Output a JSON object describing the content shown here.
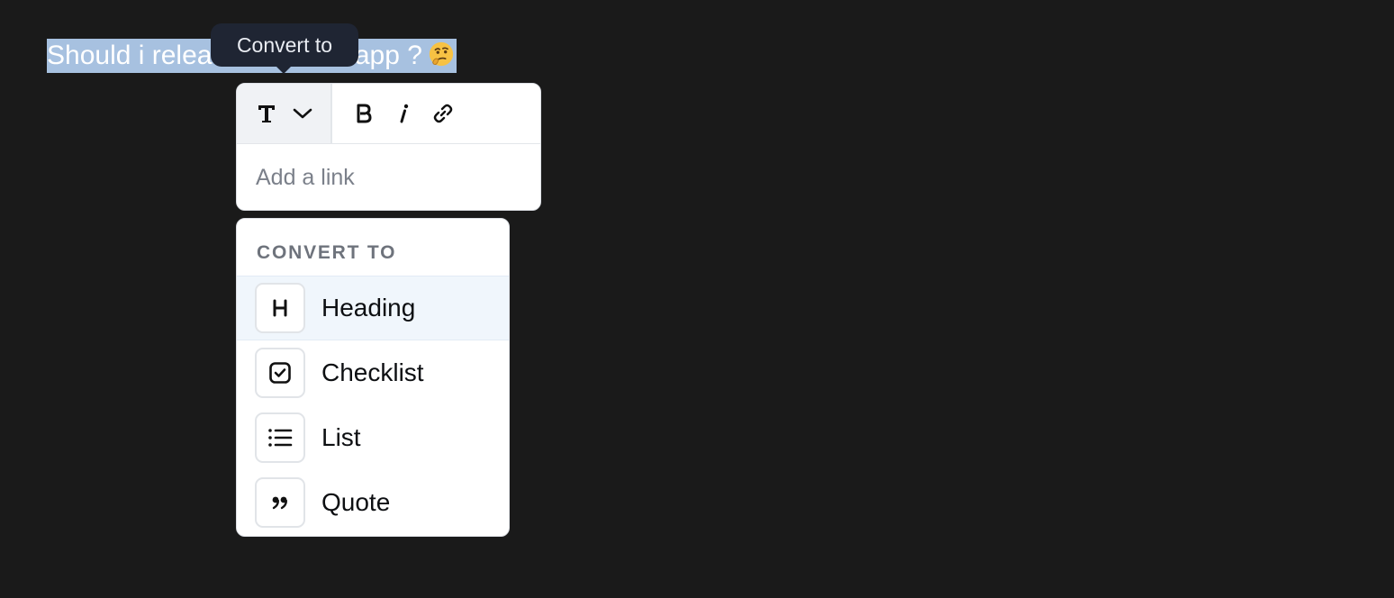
{
  "editor": {
    "selected_text": "Should i release this web app ?",
    "emoji": "🤔"
  },
  "tooltip": {
    "text": "Convert to"
  },
  "toolbar": {
    "convert_icon": "text-type-icon",
    "dropdown_icon": "chevron-down-icon",
    "bold_icon": "bold-icon",
    "italic_icon": "italic-icon",
    "link_icon": "link-icon",
    "link_placeholder": "Add a link",
    "link_value": ""
  },
  "convert_menu": {
    "heading": "CONVERT TO",
    "items": [
      {
        "label": "Heading",
        "icon": "heading-icon",
        "active": true
      },
      {
        "label": "Checklist",
        "icon": "checklist-icon",
        "active": false
      },
      {
        "label": "List",
        "icon": "list-icon",
        "active": false
      },
      {
        "label": "Quote",
        "icon": "quote-icon",
        "active": false
      }
    ]
  },
  "colors": {
    "background": "#1a1a1a",
    "selection": "#b3cff1",
    "tooltip_bg": "#1f2533",
    "menu_active_bg": "#f0f6fc",
    "muted_text": "#6e737c"
  }
}
